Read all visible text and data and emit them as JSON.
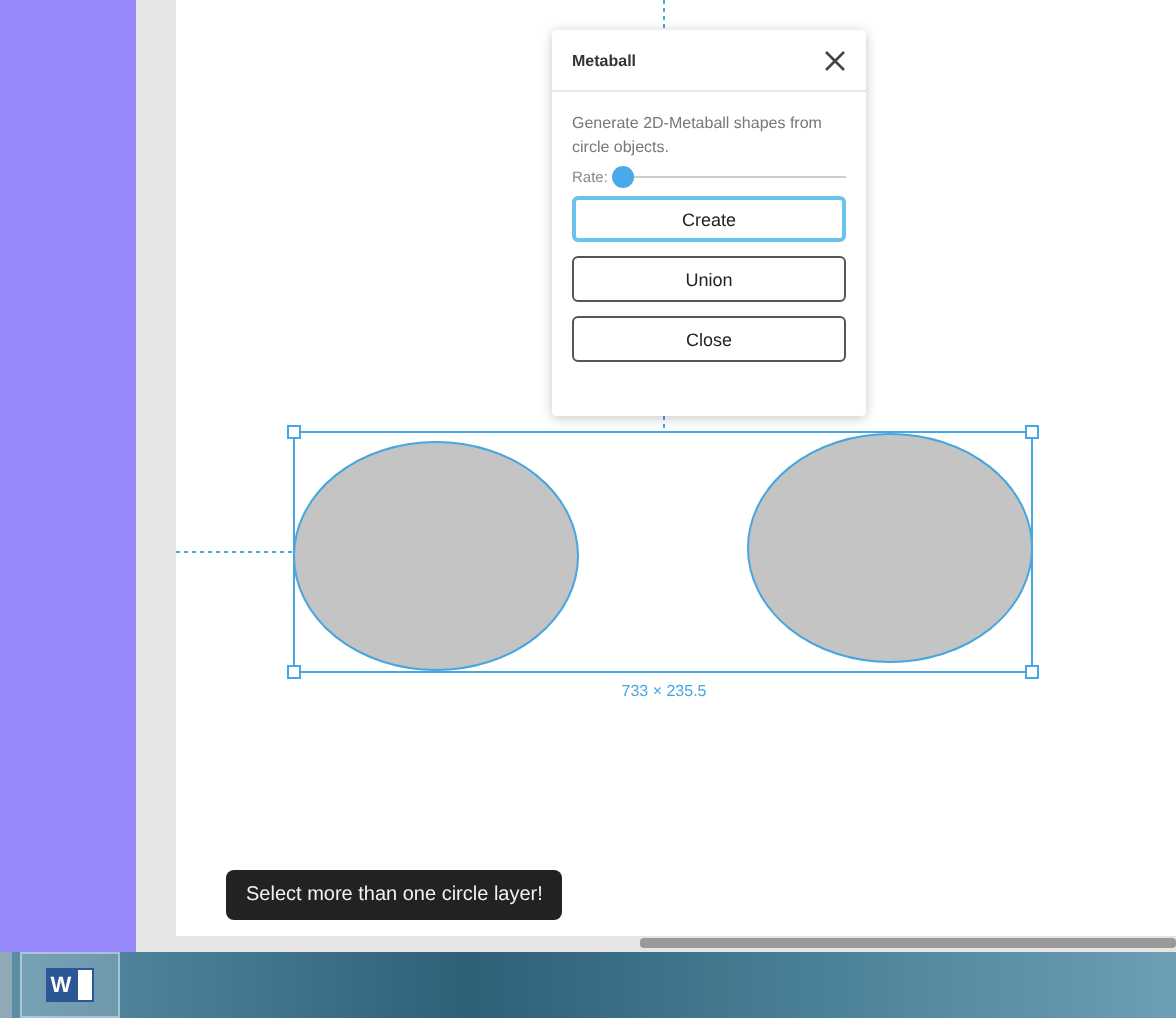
{
  "plugin_dialog": {
    "title": "Metaball",
    "description": "Generate 2D-Metaball shapes from circle objects.",
    "rate": {
      "label": "Rate:",
      "level": 0.03
    },
    "buttons": [
      {
        "label": "Create",
        "focused": true
      },
      {
        "label": "Union",
        "focused": false
      },
      {
        "label": "Close",
        "focused": false
      }
    ]
  },
  "selection": {
    "dimensions": "733 × 235.5"
  },
  "toast": "Select more than one circle layer!",
  "taskbar": {
    "app_icon_letter": "W"
  }
}
